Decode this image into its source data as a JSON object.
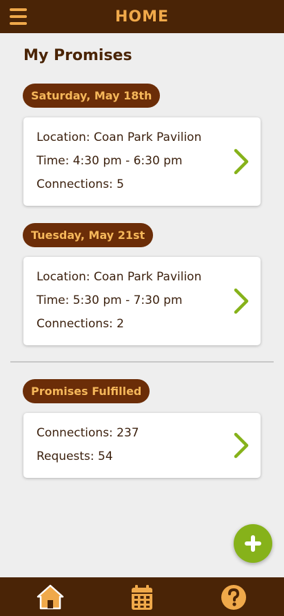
{
  "header": {
    "title": "HOME",
    "menu_icon": "hamburger-menu-icon"
  },
  "section_title": "My Promises",
  "promises": [
    {
      "date": "Saturday, May 18th",
      "location": "Location: Coan Park Pavilion",
      "time": "Time: 4:30 pm - 6:30 pm",
      "connections": "Connections: 5"
    },
    {
      "date": "Tuesday, May 21st",
      "location": "Location: Coan Park Pavilion",
      "time": "Time: 5:30 pm - 7:30 pm",
      "connections": "Connections: 2"
    }
  ],
  "fulfilled": {
    "label": "Promises Fulfilled",
    "connections": "Connections: 237",
    "requests": "Requests: 54"
  },
  "fab_icon": "plus-icon",
  "bottom_nav": [
    {
      "icon": "home-icon",
      "active": true
    },
    {
      "icon": "calendar-icon",
      "active": false
    },
    {
      "icon": "help-icon",
      "active": false
    }
  ],
  "colors": {
    "header_bg": "#4a2406",
    "accent_orange": "#f0a94a",
    "pill_bg": "#6b2d08",
    "chevron_green": "#86b21a",
    "fab_green": "#86b21a",
    "page_bg": "#eeeeee"
  }
}
